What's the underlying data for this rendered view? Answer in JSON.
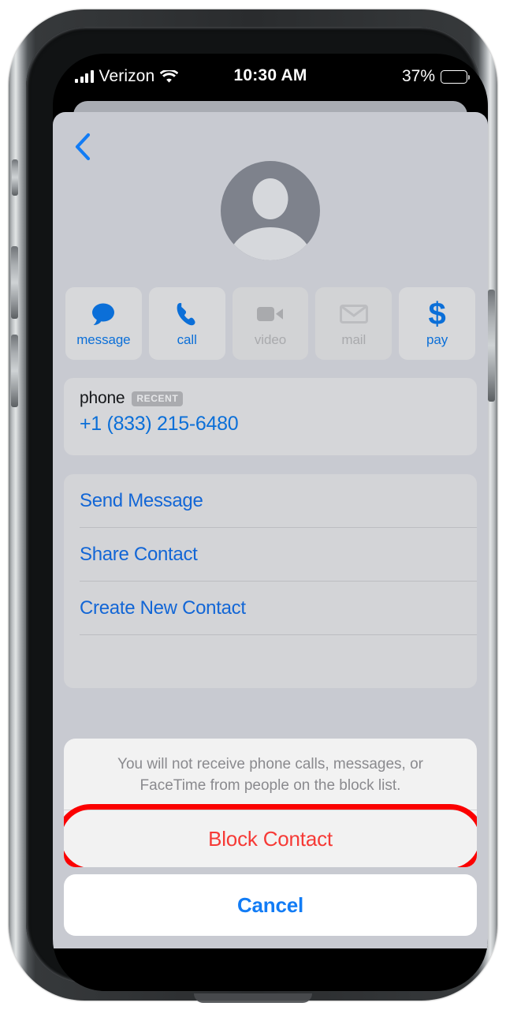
{
  "device": {
    "hardware": {
      "earpiece": "earpiece-speaker",
      "camera": "front-camera",
      "mute_switch": "mute-switch",
      "volume_up": "volume-up-button",
      "volume_down": "volume-down-button",
      "power": "power-button"
    }
  },
  "status_bar": {
    "carrier": "Verizon",
    "signal_icon": "cellular-signal-icon",
    "wifi_icon": "wifi-icon",
    "time": "10:30 AM",
    "battery_percent": "37%",
    "battery_level": 37,
    "battery_icon": "battery-icon"
  },
  "contact_card": {
    "back_icon": "back-chevron-icon",
    "avatar_icon": "default-contact-avatar-icon",
    "quick_actions": [
      {
        "label": "message",
        "icon": "message-bubble-icon",
        "enabled": true
      },
      {
        "label": "call",
        "icon": "phone-handset-icon",
        "enabled": true
      },
      {
        "label": "video",
        "icon": "video-camera-icon",
        "enabled": false
      },
      {
        "label": "mail",
        "icon": "envelope-icon",
        "enabled": false
      },
      {
        "label": "pay",
        "icon": "dollar-sign-icon",
        "enabled": true
      }
    ],
    "phone_section": {
      "label": "phone",
      "badge": "RECENT",
      "number": "+1 (833) 215-6480"
    },
    "actions": [
      {
        "label": "Send Message"
      },
      {
        "label": "Share Contact"
      },
      {
        "label": "Create New Contact"
      }
    ]
  },
  "action_sheet": {
    "description": "You will not receive phone calls, messages, or FaceTime from people on the block list.",
    "block_label": "Block Contact",
    "cancel_label": "Cancel",
    "highlighted_item": "Block Contact"
  },
  "colors": {
    "accent_blue": "#0b6fd8",
    "link_blue": "#1266d6",
    "cancel_blue": "#127cf5",
    "destructive_red": "#f63a36",
    "highlight_ring_red": "#fb0000",
    "card_background": "#c8cad1",
    "sheet_background": "#f2f2f2",
    "tile_background": "#d7d8da",
    "avatar_gray": "#7e828c"
  }
}
